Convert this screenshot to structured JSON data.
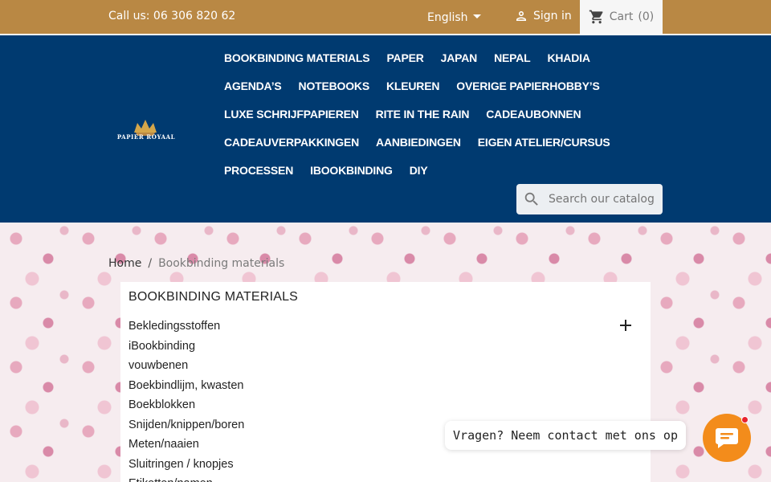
{
  "topbar": {
    "call_text": "Call us: 06 306 820 62",
    "language": "English",
    "signin_label": "Sign in",
    "cart_label": "Cart",
    "cart_count": "(0)"
  },
  "logo": {
    "text": "PAPIER ROYAAL"
  },
  "nav": {
    "rows": [
      [
        "BOOKBINDING MATERIALS",
        "PAPER",
        "JAPAN",
        "NEPAL",
        "KHADIA"
      ],
      [
        "AGENDA’S",
        "NOTEBOOKS",
        "KLEUREN",
        "OVERIGE PAPIERHOBBY’S"
      ],
      [
        "LUXE SCHRIJFPAPIEREN",
        "RITE IN THE RAIN",
        "CADEAUBONNEN"
      ],
      [
        "CADEAUVERPAKKINGEN",
        "AANBIEDINGEN",
        "EIGEN ATELIER/CURSUS"
      ],
      [
        "PROCESSEN",
        "IBOOKBINDING",
        "DIY"
      ]
    ]
  },
  "search": {
    "placeholder": "Search our catalog"
  },
  "breadcrumb": {
    "home": "Home",
    "separator": "/",
    "current": "Bookbinding materials"
  },
  "category_panel": {
    "title": "BOOKBINDING MATERIALS",
    "items": [
      "Bekledingsstoffen",
      "iBookbinding",
      "vouwbenen",
      "Boekbindlijm, kwasten",
      "Boekblokken",
      "Snijden/knippen/boren",
      "Meten/naaien",
      "Sluitringen / knopjes",
      "Etiketten/namen"
    ]
  },
  "chat": {
    "bubble_text": "Vragen? Neem contact met ons op"
  },
  "colors": {
    "topbar": "#b98844",
    "header": "#003a70",
    "chat_button": "#f38c1b",
    "notification_dot": "#e8232f"
  },
  "icons": [
    "user-icon",
    "cart-icon",
    "logo-crown-icon",
    "search-icon",
    "plus-icon",
    "chat-icon"
  ]
}
